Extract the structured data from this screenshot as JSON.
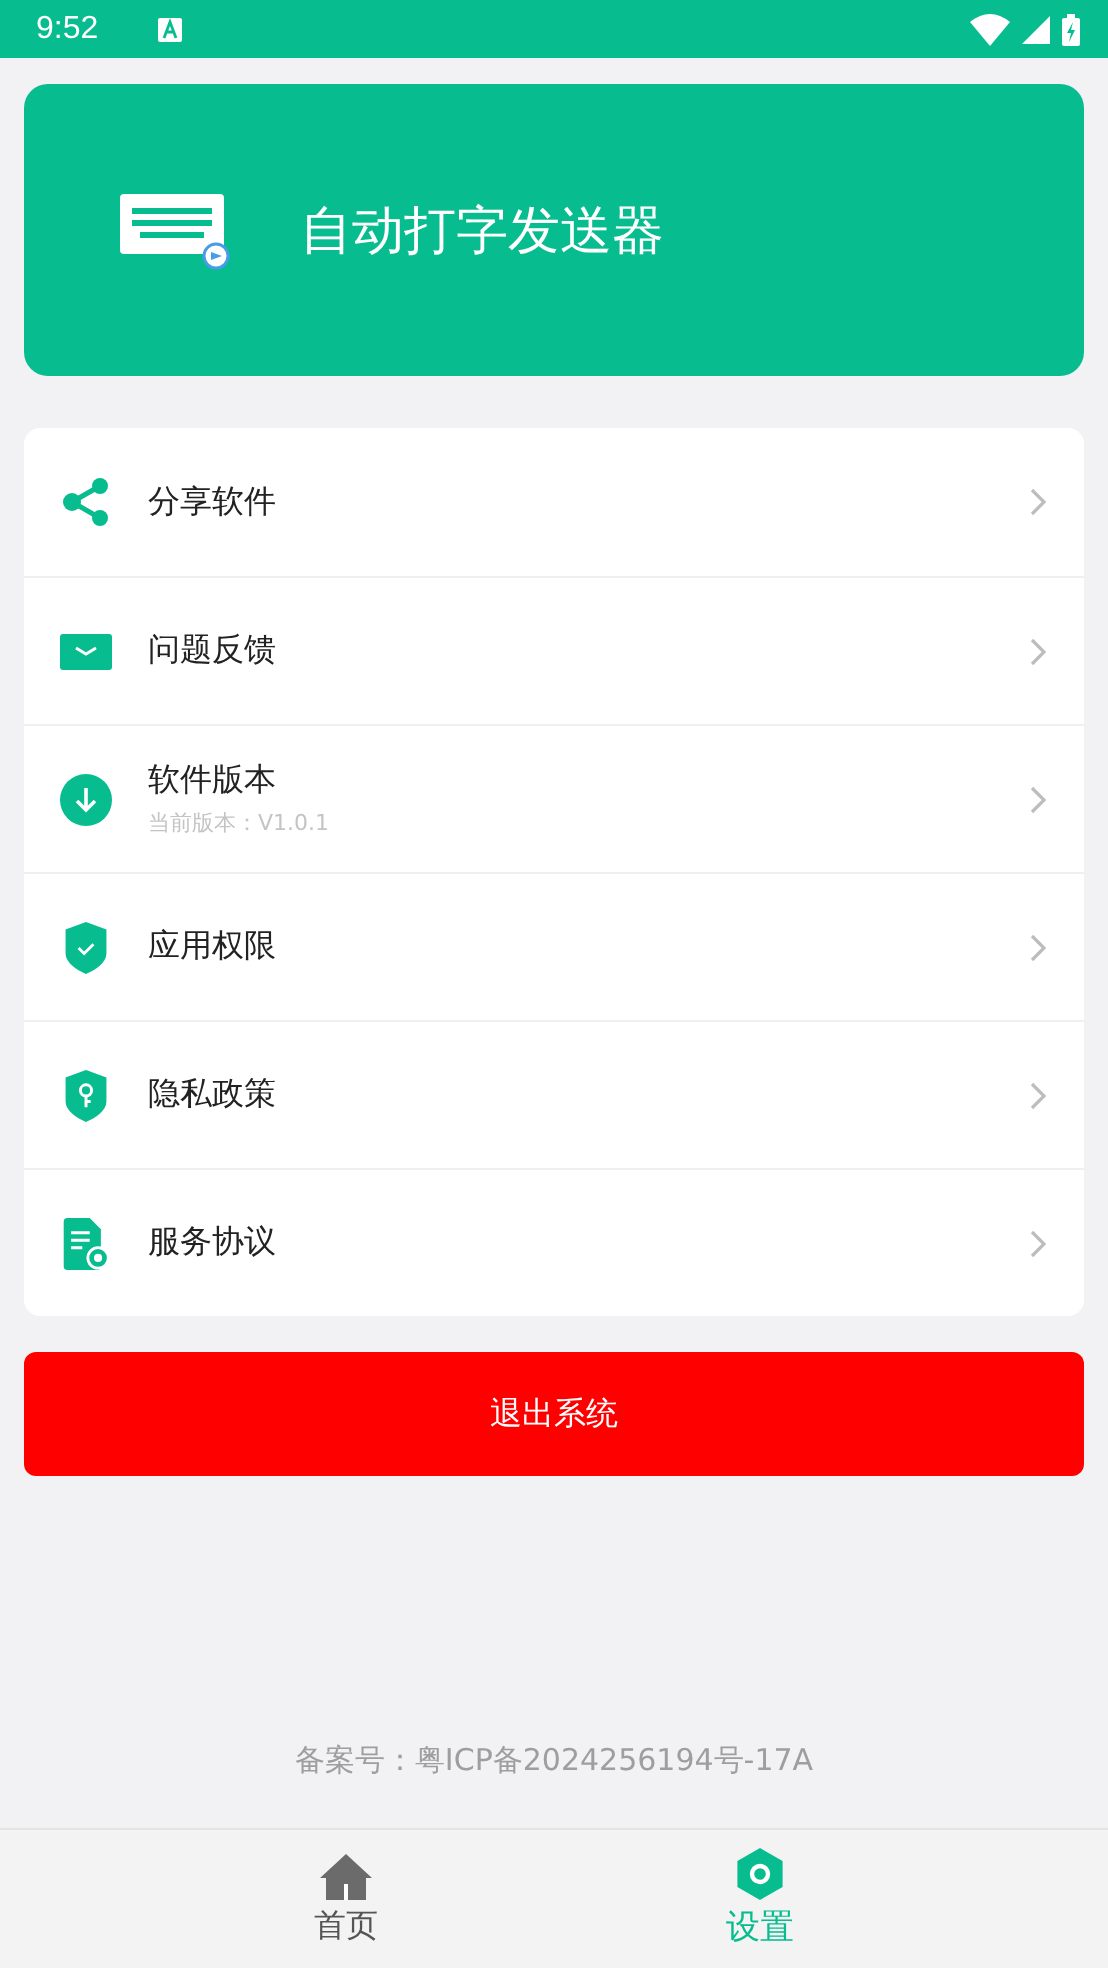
{
  "status_bar": {
    "time": "9:52"
  },
  "header": {
    "title": "自动打字发送器"
  },
  "menu": [
    {
      "kind": "share",
      "label": "分享软件"
    },
    {
      "kind": "mail",
      "label": "问题反馈"
    },
    {
      "kind": "download",
      "label": "软件版本",
      "subtitle": "当前版本：V1.0.1"
    },
    {
      "kind": "shield-check",
      "label": "应用权限"
    },
    {
      "kind": "shield-key",
      "label": "隐私政策"
    },
    {
      "kind": "document",
      "label": "服务协议"
    }
  ],
  "logout_button": "退出系统",
  "icp": "备案号：粤ICP备2024256194号-17A",
  "bottom_nav": [
    {
      "kind": "home",
      "label": "首页",
      "selected": false
    },
    {
      "kind": "settings",
      "label": "设置",
      "selected": true
    }
  ]
}
